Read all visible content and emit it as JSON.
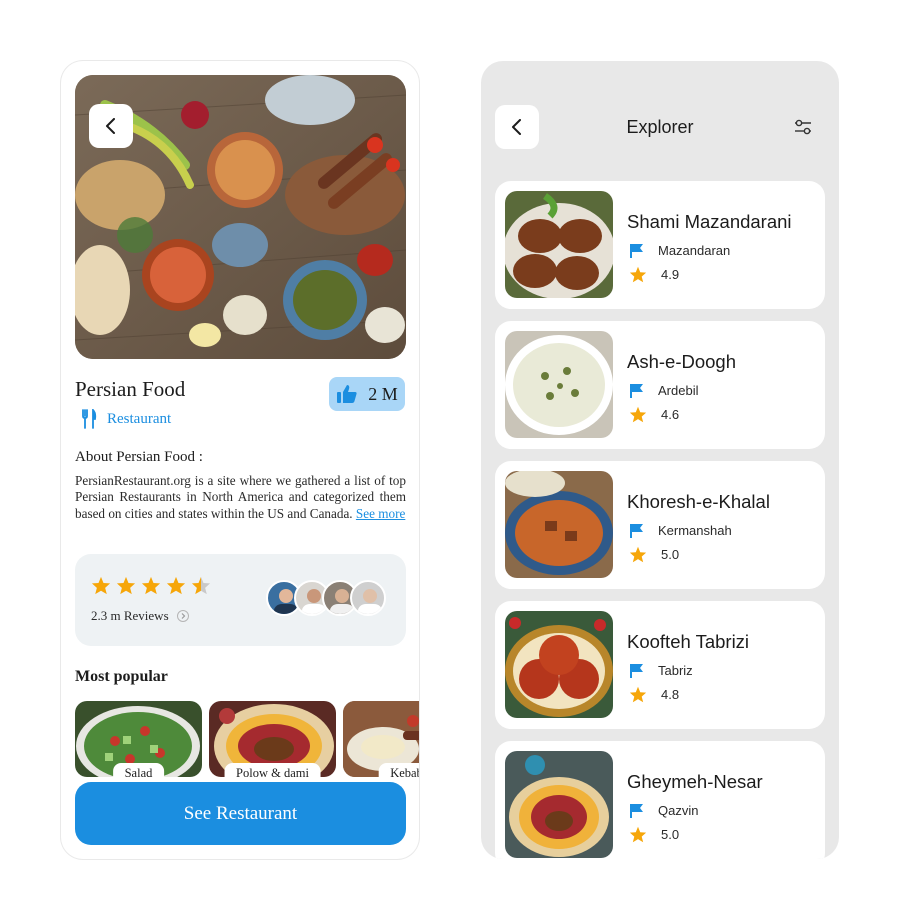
{
  "detail": {
    "title": "Persian Food",
    "category": "Restaurant",
    "likes": "2 M",
    "about_heading": "About Persian Food :",
    "about_text": "PersianRestaurant.org is a site where we gathered a list of top Persian Restaurants in North America and categorized them based on cities and states within the US and Canada.",
    "see_more": "See more",
    "reviews": {
      "rating": 4.5,
      "count_label": "2.3 m Reviews"
    },
    "popular_heading": "Most popular",
    "popular": [
      {
        "label": "Salad"
      },
      {
        "label": "Polow & dami"
      },
      {
        "label": "Kebab"
      }
    ],
    "cta_label": "See Restaurant"
  },
  "explorer": {
    "title": "Explorer",
    "dishes": [
      {
        "name": "Shami Mazandarani",
        "region": "Mazandaran",
        "rating": "4.9"
      },
      {
        "name": "Ash-e-Doogh",
        "region": "Ardebil",
        "rating": "4.6"
      },
      {
        "name": "Khoresh-e-Khalal",
        "region": "Kermanshah",
        "rating": "5.0"
      },
      {
        "name": "Koofteh Tabrizi",
        "region": "Tabriz",
        "rating": "4.8"
      },
      {
        "name": "Gheymeh-Nesar",
        "region": "Qazvin",
        "rating": "5.0"
      }
    ]
  },
  "colors": {
    "accent": "#1b8ee0",
    "star": "#f6a609",
    "like_bg": "#a9d6f7",
    "card_bg": "#eef2f4"
  },
  "icons": [
    "back-arrow-icon",
    "fork-knife-icon",
    "thumbs-up-icon",
    "star-icon",
    "chevron-right-icon",
    "filter-icon",
    "flag-icon"
  ]
}
